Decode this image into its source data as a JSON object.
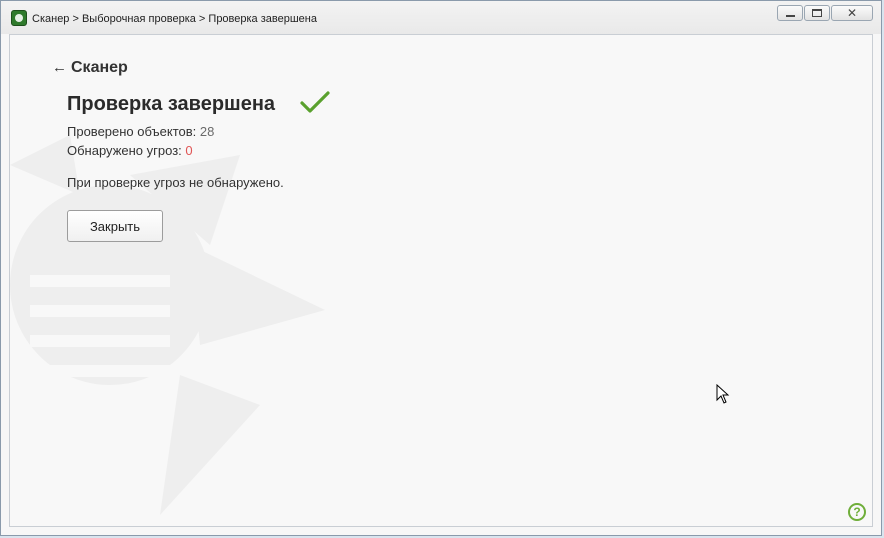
{
  "window": {
    "title": "Сканер > Выборочная проверка > Проверка завершена",
    "controls": {
      "close_glyph": "✕"
    },
    "icon": "dr-web-spider-icon"
  },
  "nav": {
    "back_arrow": "←",
    "back_label": "Сканер"
  },
  "result": {
    "title": "Проверка завершена",
    "status_icon": "check-icon",
    "status_color": "#5aa12e",
    "checked_label": "Проверено объектов: ",
    "checked_value": "28",
    "threats_label": "Обнаружено угроз: ",
    "threats_value": "0",
    "threats_color": "#e05555",
    "message": "При проверке угроз не обнаружено."
  },
  "actions": {
    "close_label": "Закрыть"
  },
  "help": {
    "glyph": "?",
    "icon": "help-icon"
  }
}
